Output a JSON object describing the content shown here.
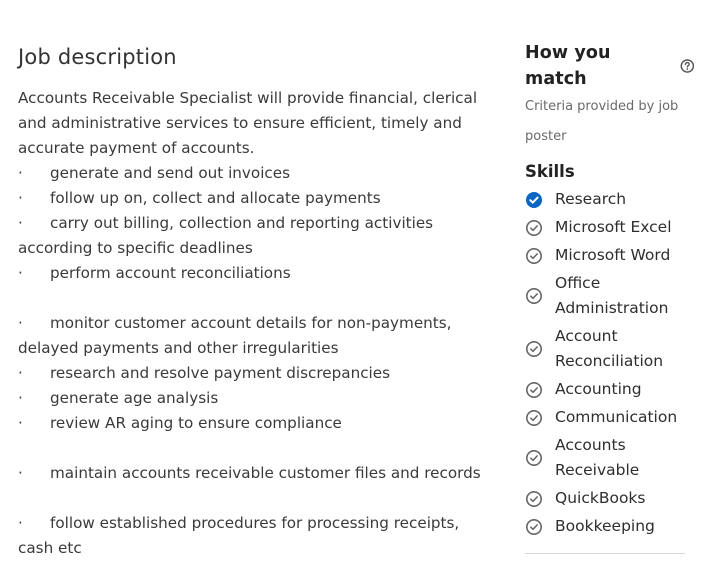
{
  "job_description": {
    "title": "Job description",
    "lines": [
      {
        "type": "text",
        "text": "Accounts Receivable Specialist will provide financial, clerical"
      },
      {
        "type": "text",
        "text": "and administrative services to ensure efficient, timely and"
      },
      {
        "type": "text",
        "text": "accurate payment of accounts."
      },
      {
        "type": "bullet",
        "text": "generate and send out invoices"
      },
      {
        "type": "bullet",
        "text": "follow up on, collect and allocate payments"
      },
      {
        "type": "bullet",
        "text": "carry out billing, collection and reporting activities"
      },
      {
        "type": "text",
        "text": "according to specific deadlines"
      },
      {
        "type": "bullet",
        "text": "perform account reconciliations"
      },
      {
        "type": "blank",
        "text": ""
      },
      {
        "type": "bullet",
        "text": "monitor customer account details for non-payments,"
      },
      {
        "type": "text",
        "text": "delayed payments and other irregularities"
      },
      {
        "type": "bullet",
        "text": "research and resolve payment discrepancies"
      },
      {
        "type": "bullet",
        "text": "generate age analysis"
      },
      {
        "type": "bullet",
        "text": "review AR aging to ensure compliance"
      },
      {
        "type": "blank",
        "text": ""
      },
      {
        "type": "bullet",
        "text": "maintain accounts receivable customer files and records"
      },
      {
        "type": "blank",
        "text": ""
      },
      {
        "type": "bullet",
        "text": "follow established procedures for processing receipts,"
      },
      {
        "type": "text",
        "text": "cash etc"
      }
    ],
    "bullet_glyph": "·"
  },
  "how_you_match": {
    "title": "How you match",
    "help_icon": "question-circle-icon",
    "criteria_line1": "Criteria provided by job",
    "criteria_line2": "poster",
    "skills_title": "Skills",
    "skills": [
      {
        "label": "Research",
        "matched": true
      },
      {
        "label": "Microsoft Excel",
        "matched": false
      },
      {
        "label": "Microsoft Word",
        "matched": false
      },
      {
        "label": "Office Administration",
        "label_lines": [
          "Office",
          "Administration"
        ],
        "matched": false
      },
      {
        "label": "Account Reconciliation",
        "label_lines": [
          "Account",
          "Reconciliation"
        ],
        "matched": false
      },
      {
        "label": "Accounting",
        "matched": false
      },
      {
        "label": "Communication",
        "matched": false
      },
      {
        "label": "Accounts Receivable",
        "label_lines": [
          "Accounts",
          "Receivable"
        ],
        "matched": false
      },
      {
        "label": "QuickBooks",
        "matched": false
      },
      {
        "label": "Bookkeeping",
        "matched": false
      }
    ],
    "colors": {
      "matched": "#0a66c2",
      "unmatched": "#666666"
    }
  }
}
